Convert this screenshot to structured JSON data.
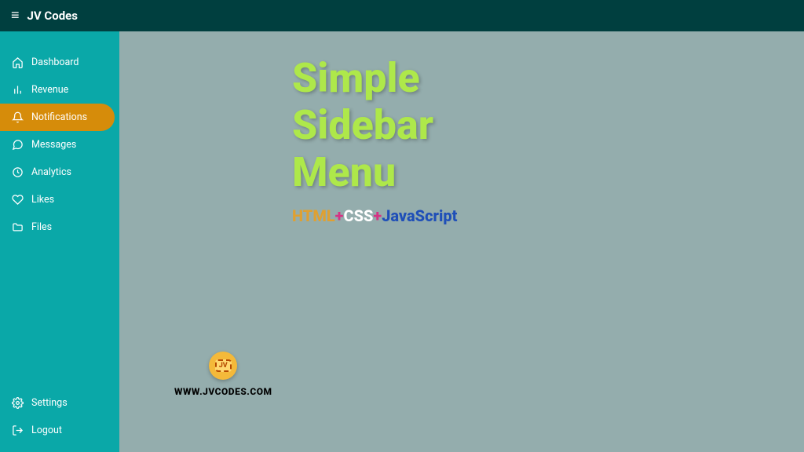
{
  "brand": "JV Codes",
  "sidebar": {
    "items_top": [
      {
        "label": "Dashboard",
        "icon": "home-icon",
        "active": false
      },
      {
        "label": "Revenue",
        "icon": "bar-chart-icon",
        "active": false
      },
      {
        "label": "Notifications",
        "icon": "bell-icon",
        "active": true
      },
      {
        "label": "Messages",
        "icon": "message-icon",
        "active": false
      },
      {
        "label": "Analytics",
        "icon": "clock-icon",
        "active": false
      },
      {
        "label": "Likes",
        "icon": "heart-icon",
        "active": false
      },
      {
        "label": "Files",
        "icon": "folder-icon",
        "active": false
      }
    ],
    "items_bottom": [
      {
        "label": "Settings",
        "icon": "gear-icon",
        "active": false
      },
      {
        "label": "Logout",
        "icon": "logout-icon",
        "active": false
      }
    ]
  },
  "hero": {
    "line1": "Simple",
    "line2": "Sidebar",
    "line3": "Menu"
  },
  "sub": {
    "html": "HTML",
    "plus": "+",
    "css": "CSS",
    "js": "JavaScript"
  },
  "logo_text": "JV",
  "footer_url": "WWW.JVCODES.COM"
}
